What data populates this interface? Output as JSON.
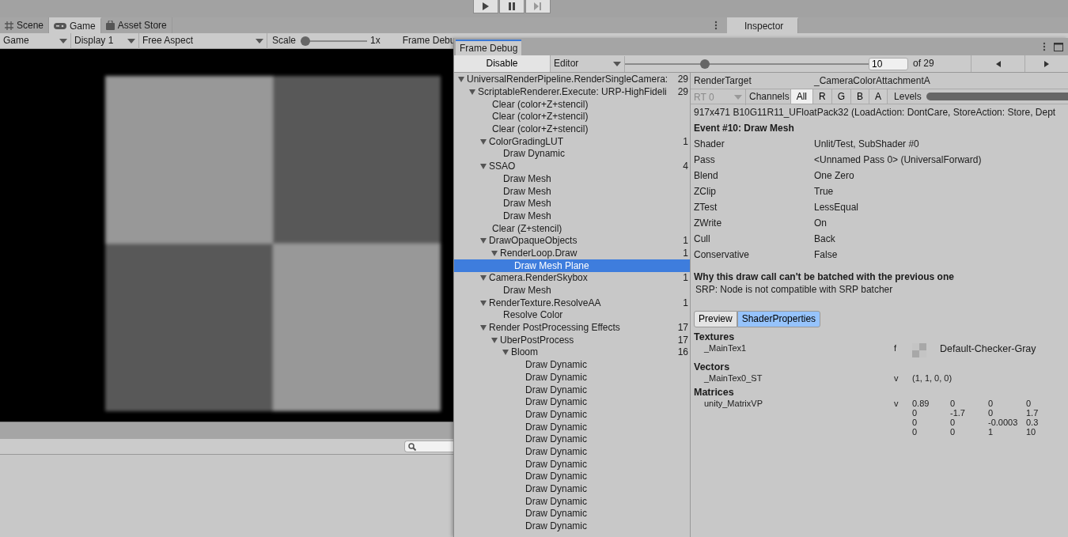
{
  "play_controls": [
    {
      "kind": "play",
      "disabled": false
    },
    {
      "kind": "pause",
      "disabled": false
    },
    {
      "kind": "step",
      "disabled": true
    }
  ],
  "dock_tabs": [
    {
      "kind": "scene",
      "label": "Scene",
      "selected": false
    },
    {
      "kind": "game",
      "label": "Game",
      "selected": true
    },
    {
      "kind": "store",
      "label": "Asset Store",
      "selected": false
    }
  ],
  "inspector_tab": {
    "label": "Inspector"
  },
  "game_toolbar": {
    "mode": "Game",
    "display": "Display 1",
    "aspect": "Free Aspect",
    "scale_label": "Scale",
    "scale": {
      "level": 0
    },
    "scale_value": "1x",
    "frame_debug_label": "Frame Debu"
  },
  "frame_debugger": {
    "title": "Frame Debug",
    "disable_button": "Disable",
    "target": "Editor",
    "event_slider": {
      "level": 0.32
    },
    "event_field": "10",
    "event_total": "of 29",
    "tree": [
      {
        "label": "UniversalRenderPipeline.RenderSingleCamera:",
        "count": "29",
        "expanded": true,
        "selected": false,
        "children": [
          {
            "label": "ScriptableRenderer.Execute: URP-HighFideli",
            "count": "29",
            "expanded": true,
            "selected": false,
            "children": [
              {
                "label": "Clear (color+Z+stencil)",
                "selected": false
              },
              {
                "label": "Clear (color+Z+stencil)",
                "selected": false
              },
              {
                "label": "Clear (color+Z+stencil)",
                "selected": false
              },
              {
                "label": "ColorGradingLUT",
                "count": "1",
                "expanded": true,
                "selected": false,
                "children": [
                  {
                    "label": "Draw Dynamic",
                    "selected": false
                  }
                ]
              },
              {
                "label": "SSAO",
                "count": "4",
                "expanded": true,
                "selected": false,
                "children": [
                  {
                    "label": "Draw Mesh",
                    "selected": false
                  },
                  {
                    "label": "Draw Mesh",
                    "selected": false
                  },
                  {
                    "label": "Draw Mesh",
                    "selected": false
                  },
                  {
                    "label": "Draw Mesh",
                    "selected": false
                  }
                ]
              },
              {
                "label": "Clear (Z+stencil)",
                "selected": false
              },
              {
                "label": "DrawOpaqueObjects",
                "count": "1",
                "expanded": true,
                "selected": false,
                "children": [
                  {
                    "label": "RenderLoop.Draw",
                    "count": "1",
                    "expanded": true,
                    "selected": false,
                    "children": [
                      {
                        "label": "Draw Mesh Plane",
                        "selected": true
                      }
                    ]
                  }
                ]
              },
              {
                "label": "Camera.RenderSkybox",
                "count": "1",
                "expanded": true,
                "selected": false,
                "children": [
                  {
                    "label": "Draw Mesh",
                    "selected": false
                  }
                ]
              },
              {
                "label": "RenderTexture.ResolveAA",
                "count": "1",
                "expanded": true,
                "selected": false,
                "children": [
                  {
                    "label": "Resolve Color",
                    "selected": false
                  }
                ]
              },
              {
                "label": "Render PostProcessing Effects",
                "count": "17",
                "expanded": true,
                "selected": false,
                "children": [
                  {
                    "label": "UberPostProcess",
                    "count": "17",
                    "expanded": true,
                    "selected": false,
                    "children": [
                      {
                        "label": "Bloom",
                        "count": "16",
                        "expanded": true,
                        "selected": false,
                        "children": [
                          {
                            "label": "Draw Dynamic",
                            "selected": false
                          },
                          {
                            "label": "Draw Dynamic",
                            "selected": false
                          },
                          {
                            "label": "Draw Dynamic",
                            "selected": false
                          },
                          {
                            "label": "Draw Dynamic",
                            "selected": false
                          },
                          {
                            "label": "Draw Dynamic",
                            "selected": false
                          },
                          {
                            "label": "Draw Dynamic",
                            "selected": false
                          },
                          {
                            "label": "Draw Dynamic",
                            "selected": false
                          },
                          {
                            "label": "Draw Dynamic",
                            "selected": false
                          },
                          {
                            "label": "Draw Dynamic",
                            "selected": false
                          },
                          {
                            "label": "Draw Dynamic",
                            "selected": false
                          },
                          {
                            "label": "Draw Dynamic",
                            "selected": false
                          },
                          {
                            "label": "Draw Dynamic",
                            "selected": false
                          },
                          {
                            "label": "Draw Dynamic",
                            "selected": false
                          },
                          {
                            "label": "Draw Dynamic",
                            "selected": false
                          }
                        ]
                      }
                    ]
                  }
                ]
              }
            ]
          }
        ]
      }
    ],
    "details": {
      "render_target_label": "RenderTarget",
      "render_target": "_CameraColorAttachmentA",
      "rt_dropdown": {
        "label": "RT 0",
        "disabled": true
      },
      "channels_label": "Channels",
      "channels": [
        {
          "label": "All",
          "selected": true
        },
        {
          "label": "R",
          "selected": false
        },
        {
          "label": "G",
          "selected": false
        },
        {
          "label": "B",
          "selected": false
        },
        {
          "label": "A",
          "selected": false
        }
      ],
      "levels_label": "Levels",
      "levels": {
        "level": 1
      },
      "format_info": "917x471 B10G11R11_UFloatPack32 (LoadAction: DontCare, StoreAction: Store, Dept",
      "event_title": "Event #10: Draw Mesh",
      "properties": [
        {
          "label": "Shader",
          "value": "Unlit/Test, SubShader #0"
        },
        {
          "label": "Pass",
          "value": "<Unnamed Pass 0> (UniversalForward)"
        },
        {
          "label": "Blend",
          "value": "One Zero"
        },
        {
          "label": "ZClip",
          "value": "True"
        },
        {
          "label": "ZTest",
          "value": "LessEqual"
        },
        {
          "label": "ZWrite",
          "value": "On"
        },
        {
          "label": "Cull",
          "value": "Back"
        },
        {
          "label": "Conservative",
          "value": "False"
        }
      ],
      "batch_heading": "Why this draw call can't be batched with the previous one",
      "batch_reason": "SRP: Node is not compatible with SRP batcher",
      "view_tabs": [
        {
          "label": "Preview",
          "selected": false
        },
        {
          "label": "ShaderProperties",
          "selected": true
        }
      ],
      "sections": [
        {
          "title": "Textures",
          "entries": [
            {
              "kind": "texture",
              "name": "_MainTex1",
              "type": "f",
              "value": "Default-Checker-Gray"
            }
          ]
        },
        {
          "title": "Vectors",
          "entries": [
            {
              "kind": "vector",
              "name": "_MainTex0_ST",
              "type": "v",
              "value": "(1, 1, 0, 0)"
            }
          ]
        },
        {
          "title": "Matrices",
          "entries": [
            {
              "kind": "matrix",
              "name": "unity_MatrixVP",
              "type": "v",
              "rows": [
                [
                  "0.89",
                  "0",
                  "0",
                  "0"
                ],
                [
                  "0",
                  "-1.7",
                  "0",
                  "1.7"
                ],
                [
                  "0",
                  "0",
                  "-0.0003",
                  "0.3"
                ],
                [
                  "0",
                  "0",
                  "1",
                  "10"
                ]
              ]
            }
          ]
        }
      ]
    }
  }
}
